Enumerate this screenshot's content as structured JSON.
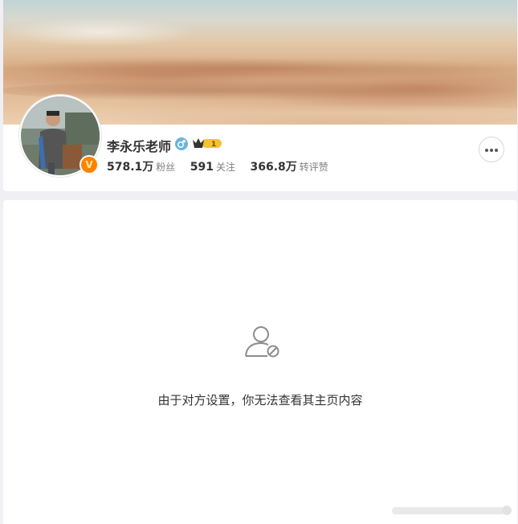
{
  "profile": {
    "name": "李永乐老师",
    "stats": [
      {
        "value": "578.1万",
        "label": "粉丝"
      },
      {
        "value": "591",
        "label": "关注"
      },
      {
        "value": "366.8万",
        "label": "转评赞"
      }
    ]
  },
  "icons": {
    "gender": "male-gender-icon",
    "crown": "vip-crown-icon",
    "verified": "verified-v-icon",
    "more": "more-options-icon",
    "empty": "user-blocked-icon"
  },
  "colors": {
    "verified_badge": "#ff8200",
    "gender_icon": "#6cb3e0",
    "vip_badge": "#f5c230"
  },
  "empty_state": {
    "message": "由于对方设置，你无法查看其主页内容"
  }
}
